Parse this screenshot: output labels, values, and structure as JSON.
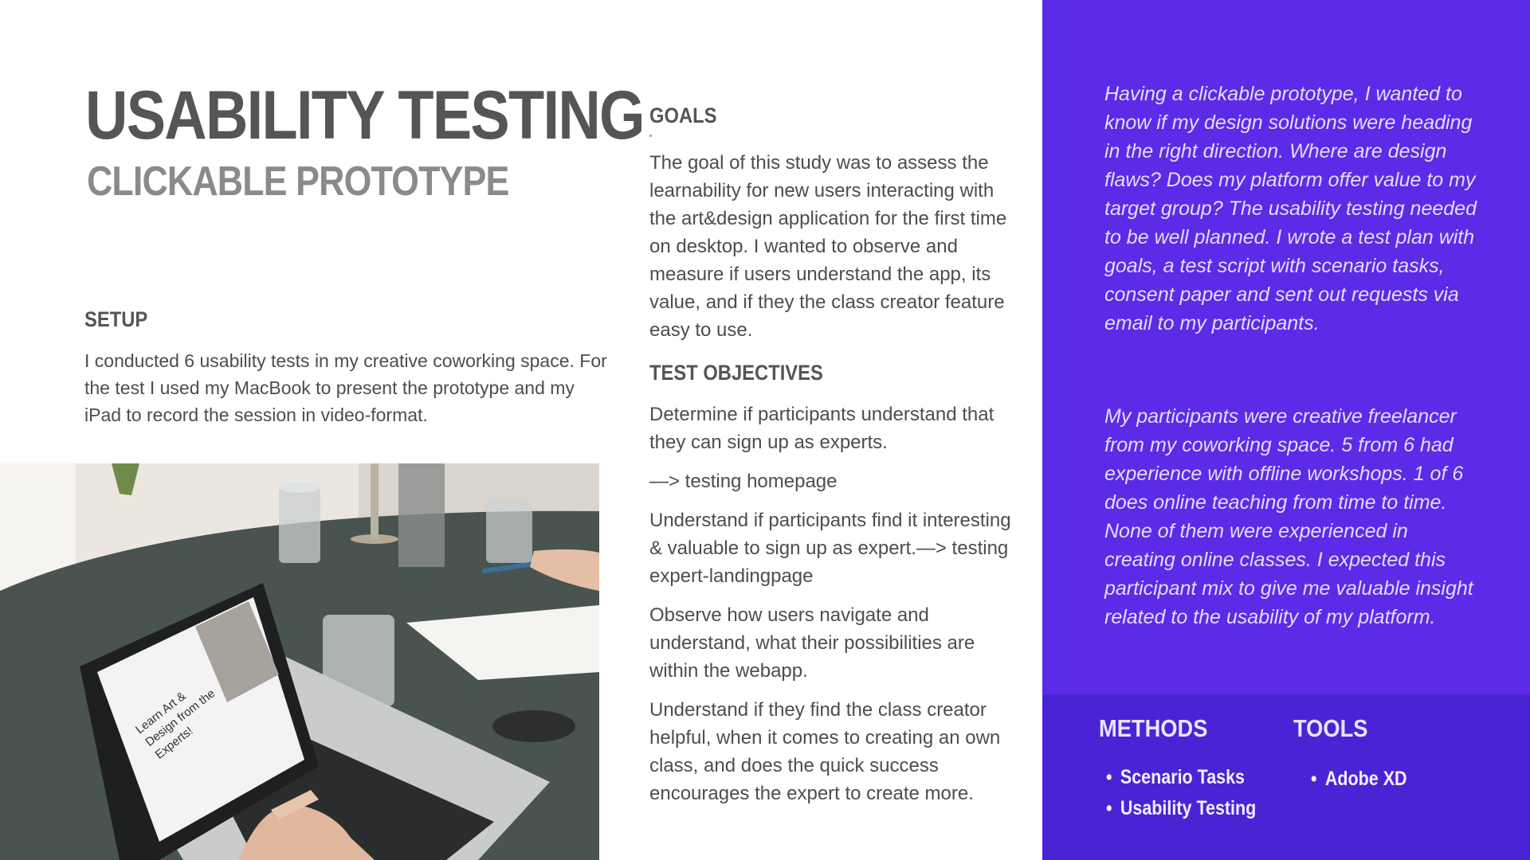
{
  "header": {
    "title": "USABILITY TESTING",
    "subtitle": "CLICKABLE PROTOTYPE"
  },
  "setup": {
    "heading": "SETUP",
    "text": "I conducted 6 usability tests in my  creative coworking space. For the test I used my MacBook to present the prototype and my iPad to record the session in video-format."
  },
  "photo": {
    "screen_lines": [
      "Learn Art &",
      "Design from the",
      "Experts!"
    ]
  },
  "goals": {
    "heading": "GOALS",
    "text": "The goal of this study was to assess the learnability for new users interacting with the art&design application for the first time on desktop. I wanted to observe and measure if users understand the app, its value, and if they the class creator feature easy to use."
  },
  "objectives": {
    "heading": "TEST OBJECTIVES",
    "items": [
      "Determine if participants understand that they can sign up as experts.",
      "—> testing homepage",
      "Understand if participants find it interesting & valuable to sign up as expert.—> testing expert-landingpage",
      "Observe how users navigate and understand, what their possibilities are within the webapp.",
      "Understand if they find the class creator helpful, when it comes to creating an own class, and does the quick success encourages the expert to create more."
    ]
  },
  "panel": {
    "paragraph1": "Having a clickable prototype, I wanted to know if my design solutions were heading in the right direction. Where are design flaws? Does my platform offer value to my target group? The usability testing needed to be well planned. I wrote a test plan with goals, a test script with scenario tasks, consent paper and sent out requests via email to my participants.",
    "paragraph2": "My participants were creative freelancer from my coworking space. 5 from 6 had experience with offline workshops. 1 of 6 does online teaching from time to time. None of them were experienced in creating online classes. I expected this participant mix to give me valuable insight related to the usability of my platform."
  },
  "methods": {
    "heading": "METHODS",
    "items": [
      "Scenario Tasks",
      "Usability Testing"
    ]
  },
  "tools": {
    "heading": "TOOLS",
    "items": [
      "Adobe XD"
    ]
  },
  "colors": {
    "panel": "#5b2be8",
    "panel_bottom": "#4a24d4",
    "heading": "#555555",
    "body": "#4d4d4d"
  }
}
